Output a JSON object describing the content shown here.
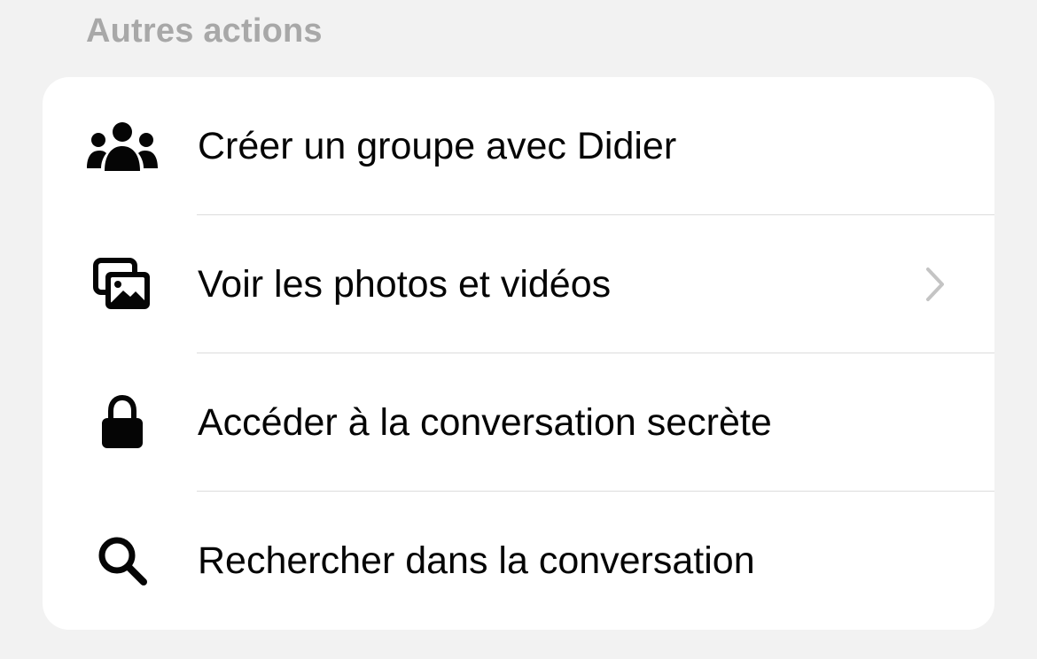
{
  "section": {
    "title": "Autres actions"
  },
  "actions": [
    {
      "label": "Créer un groupe avec Didier",
      "icon": "group-icon",
      "has_chevron": false
    },
    {
      "label": "Voir les photos et vidéos",
      "icon": "photos-icon",
      "has_chevron": true
    },
    {
      "label": "Accéder à la conversation secrète",
      "icon": "lock-icon",
      "has_chevron": false
    },
    {
      "label": "Rechercher dans la conversation",
      "icon": "search-icon",
      "has_chevron": false
    }
  ],
  "colors": {
    "background": "#f2f2f2",
    "card": "#ffffff",
    "header_text": "#a8a8a8",
    "label_text": "#050505",
    "divider": "#dcdcdc",
    "chevron": "#c4c4c4"
  }
}
